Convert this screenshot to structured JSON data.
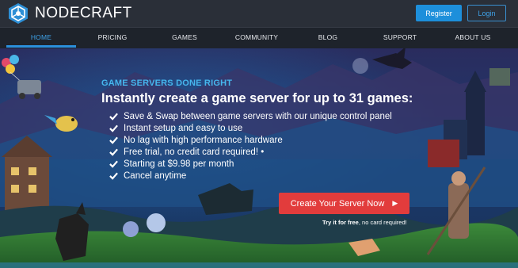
{
  "brand": {
    "name": "NODECRAFT"
  },
  "auth": {
    "register_label": "Register",
    "login_label": "Login"
  },
  "nav": {
    "items": [
      {
        "label": "HOME"
      },
      {
        "label": "PRICING"
      },
      {
        "label": "GAMES"
      },
      {
        "label": "COMMUNITY"
      },
      {
        "label": "BLOG"
      },
      {
        "label": "SUPPORT"
      },
      {
        "label": "ABOUT US"
      }
    ],
    "active": "HOME"
  },
  "hero": {
    "tagline": "GAME SERVERS DONE RIGHT",
    "headline": "Instantly create a game server for up to 31 games:",
    "features": [
      "Save & Swap between game servers with our unique control panel",
      "Instant setup and easy to use",
      "No lag with high performance hardware",
      "Free trial, no credit card required! •",
      "Starting at $9.98 per month",
      "Cancel anytime"
    ],
    "cta_label": "Create Your Server Now",
    "cta_note_bold": "Try it for free",
    "cta_note_rest": ", no card required!"
  },
  "colors": {
    "accent": "#1d8fdb",
    "tagline": "#46b7ee",
    "cta": "#e23c3c",
    "topbar": "#2a2f38",
    "navbar": "#1e232b"
  },
  "icons": [
    "nodecraft-logo-icon",
    "check-icon",
    "play-arrow-icon"
  ]
}
